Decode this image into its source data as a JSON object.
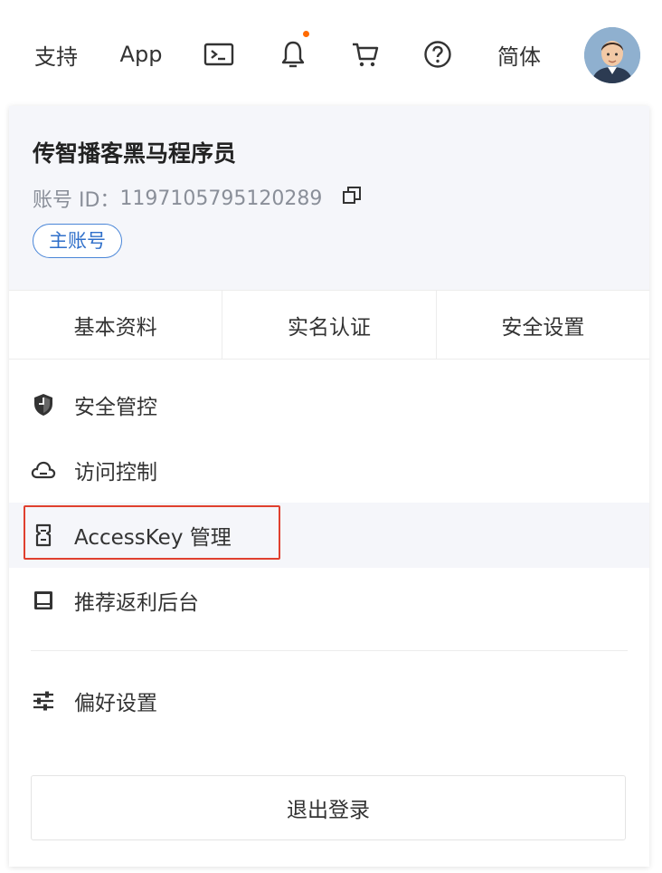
{
  "topbar": {
    "support_label": "支持",
    "app_label": "App",
    "language_label": "简体",
    "icons": [
      "terminal-icon",
      "bell-icon",
      "cart-icon",
      "help-icon"
    ],
    "notification_dot_color": "#ff6a00"
  },
  "profile": {
    "name": "传智播客黑马程序员",
    "account_id_label": "账号 ID：",
    "account_id": "1197105795120289",
    "badge": "主账号"
  },
  "tabs": [
    {
      "label": "基本资料"
    },
    {
      "label": "实名认证"
    },
    {
      "label": "安全设置"
    }
  ],
  "menu": [
    {
      "label": "安全管控",
      "icon": "shield-icon"
    },
    {
      "label": "访问控制",
      "icon": "cloud-icon"
    },
    {
      "label": "AccessKey 管理",
      "icon": "key-icon",
      "active": true
    },
    {
      "label": "推荐返利后台",
      "icon": "monitor-icon"
    }
  ],
  "preferences": {
    "label": "偏好设置",
    "icon": "sliders-icon"
  },
  "logout_label": "退出登录",
  "colors": {
    "accent": "#2f6fca",
    "highlight": "#e0402f",
    "panel_bg": "#f5f6fa"
  }
}
